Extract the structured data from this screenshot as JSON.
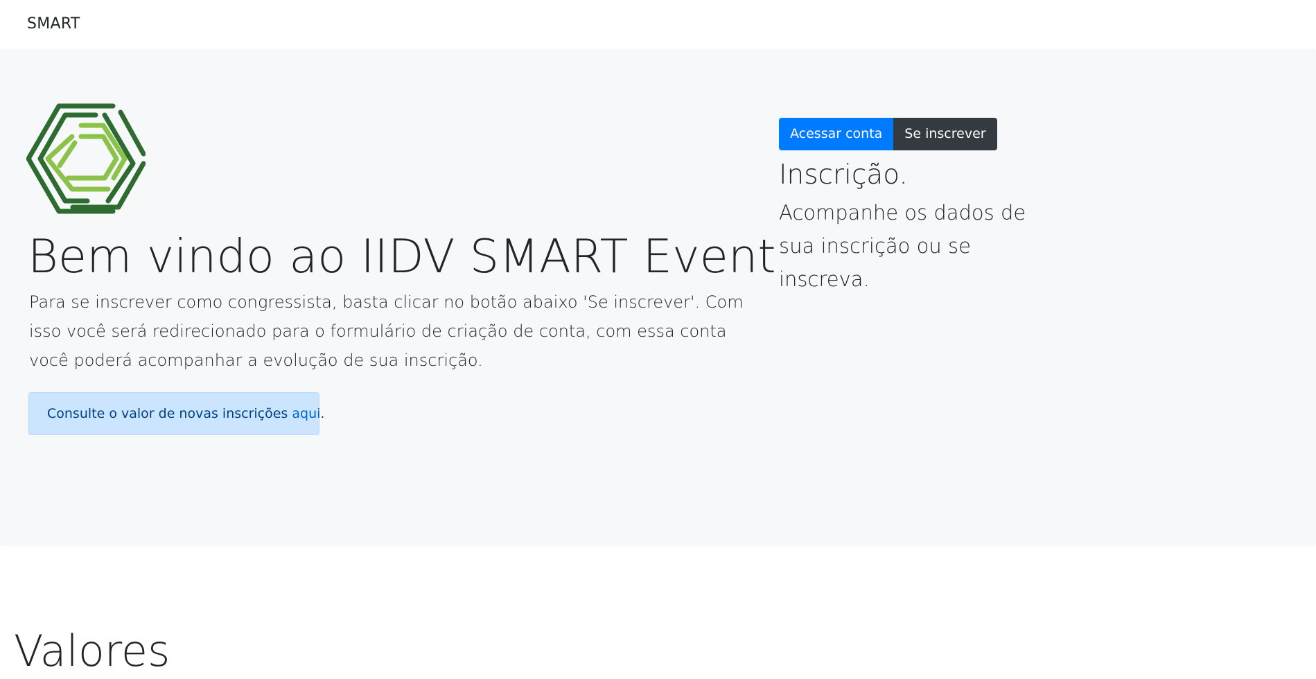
{
  "navbar": {
    "brand": "SMART"
  },
  "hero": {
    "logo_icon": "hexagon-maze-logo",
    "title": "Bem vindo ao IIDV SMART Event",
    "lead": "Para se inscrever como congressista, basta clicar no botão abaixo 'Se inscrever'. Com isso você será redirecionado para o formulário de criação de conta, com essa conta você poderá acompanhar a evolução de sua inscrição.",
    "alert": {
      "text": "Consulte o valor de novas inscrições ",
      "link_label": "aqui",
      "suffix": "."
    }
  },
  "side": {
    "login_button": "Acessar conta",
    "register_button": "Se inscrever",
    "title": "Inscrição.",
    "text": "Acompanhe os dados de sua inscrição ou se inscreva."
  },
  "section": {
    "title": "Valores"
  },
  "colors": {
    "primary": "#007bff",
    "dark": "#343a40",
    "jumbotron_bg": "#f7f8fa",
    "alert_bg": "#cce5ff",
    "logo_dark_green": "#2e6b30",
    "logo_light_green": "#8bc34a"
  }
}
